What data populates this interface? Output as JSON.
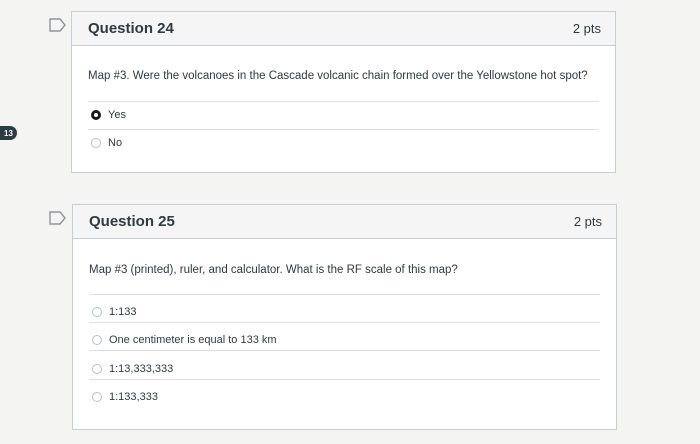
{
  "question_number_badge": "13",
  "questions": [
    {
      "title": "Question 24",
      "points": "2 pts",
      "text": "Map #3. Were the volcanoes in the Cascade volcanic chain formed over the Yellowstone hot spot?",
      "answers": [
        {
          "label": "Yes",
          "selected": true
        },
        {
          "label": "No",
          "selected": false
        }
      ]
    },
    {
      "title": "Question 25",
      "points": "2 pts",
      "text": "Map #3 (printed), ruler, and calculator. What is the RF scale of this map?",
      "answers": [
        {
          "label": "1:133",
          "selected": false
        },
        {
          "label": "One centimeter is equal to 133 km",
          "selected": false
        },
        {
          "label": "1:13,333,333",
          "selected": false
        },
        {
          "label": "1:133,333",
          "selected": false
        }
      ]
    }
  ]
}
